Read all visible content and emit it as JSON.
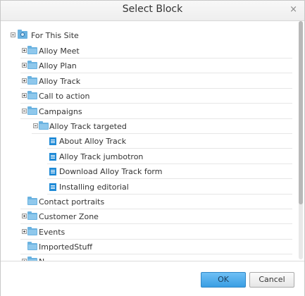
{
  "dialog": {
    "title": "Select Block",
    "close_glyph": "×",
    "ok_label": "OK",
    "cancel_label": "Cancel"
  },
  "tree": {
    "root": "For This Site",
    "items": [
      "Alloy Meet",
      "Alloy Plan",
      "Alloy Track",
      "Call to action",
      "Campaigns",
      "Alloy Track targeted",
      "About Alloy Track",
      "Alloy Track jumbotron",
      "Download Alloy Track form",
      "Installing editorial",
      "Contact portraits",
      "Customer Zone",
      "Events",
      "ImportedStuff",
      "N..."
    ]
  },
  "icons": {
    "root": "site-folder-icon",
    "folder": "folder-icon",
    "block": "block-icon",
    "expand": "expand-plus-icon",
    "collapse": "collapse-minus-icon"
  },
  "colors": {
    "ok_button": "#3a9ee3",
    "folder": "#6ab2e0",
    "block_icon": "#1f8ad6"
  }
}
